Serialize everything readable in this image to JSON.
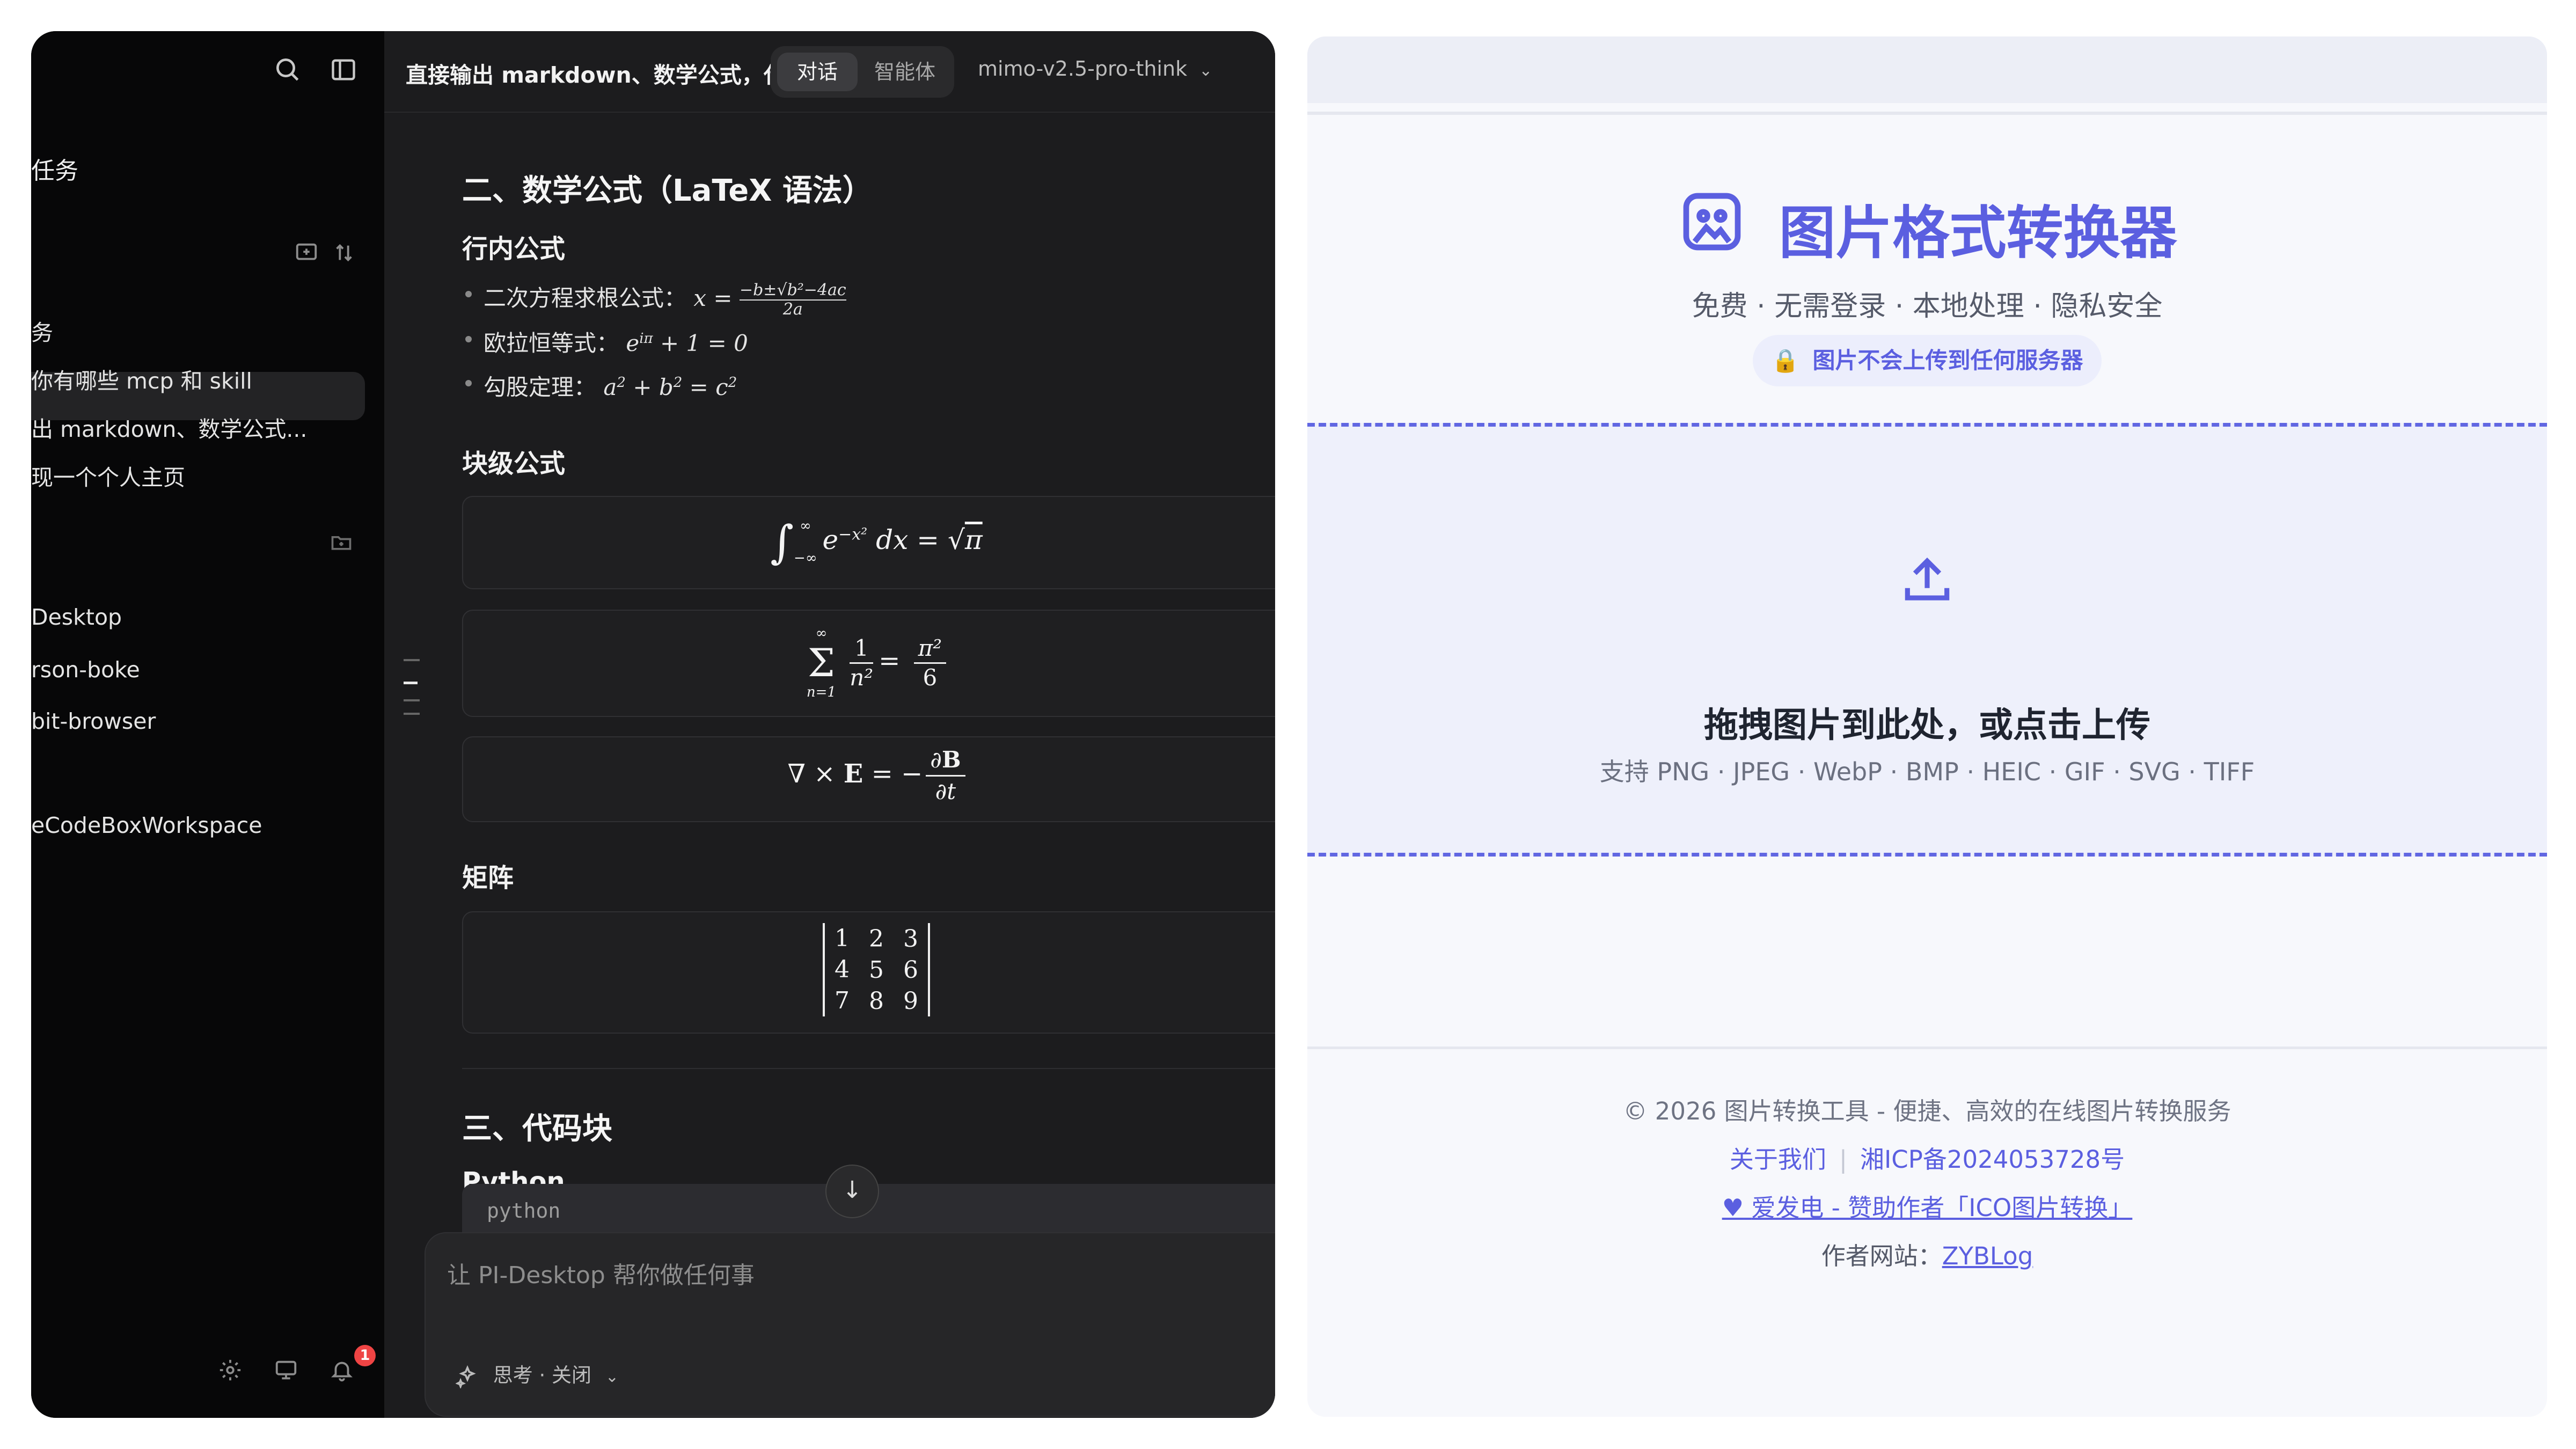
{
  "left_app": {
    "sidebar": {
      "tasks_heading": "任务",
      "section_label": "务",
      "chats": [
        "你有哪些 mcp 和 skill",
        "出 markdown、数学公式...",
        "现一个个人主页"
      ],
      "folders": [
        "Desktop",
        "rson-boke",
        "bit-browser",
        "eCodeBoxWorkspace"
      ],
      "notification_count": "1"
    },
    "topbar": {
      "title": "直接输出 markdown、数学公式，代...",
      "tabs": [
        "对话",
        "智能体"
      ],
      "active_tab": "对话",
      "model": "mimo-v2.5-pro-think"
    },
    "content": {
      "section_math": "二、数学公式（LaTeX 语法）",
      "inline_heading": "行内公式",
      "inline_items": [
        {
          "label": "二次方程求根公式：",
          "formula": "x = (−b±√(b²−4ac)) / 2a"
        },
        {
          "label": "欧拉恒等式：",
          "formula": "e^{iπ} + 1 = 0"
        },
        {
          "label": "勾股定理：",
          "formula": "a² + b² = c²"
        }
      ],
      "block_heading": "块级公式",
      "block_formulas": [
        "∫ e^{−x²} dx = √π  (−∞ to ∞)",
        "Σ 1/n² = π²/6  (n=1 to ∞)",
        "∇ × E = −∂B/∂t"
      ],
      "matrix_heading": "矩阵",
      "matrix": [
        [
          "1",
          "2",
          "3"
        ],
        [
          "4",
          "5",
          "6"
        ],
        [
          "7",
          "8",
          "9"
        ]
      ],
      "section_code": "三、代码块",
      "python_heading": "Python",
      "code_lang": "python"
    },
    "composer": {
      "placeholder": "让 PI-Desktop 帮你做任何事",
      "think_label": "思考 · 关闭"
    }
  },
  "right_app": {
    "title": "图片格式转换器",
    "subtitle": "免费 · 无需登录 · 本地处理 · 隐私安全",
    "privacy_badge": "图片不会上传到任何服务器",
    "dropzone": {
      "title": "拖拽图片到此处，或点击上传",
      "formats": "支持 PNG · JPEG · WebP · BMP · HEIC · GIF · SVG · TIFF"
    },
    "footer": {
      "copyright": "© 2026 图片转换工具 - 便捷、高效的在线图片转换服务",
      "about": "关于我们",
      "icp": "湘ICP备2024053728号",
      "sponsor": "爱发电 - 赞助作者「ICO图片转换」",
      "author_label": "作者网站：",
      "author_link": "ZYBLog"
    },
    "accent_color": "#5b5fe0"
  }
}
